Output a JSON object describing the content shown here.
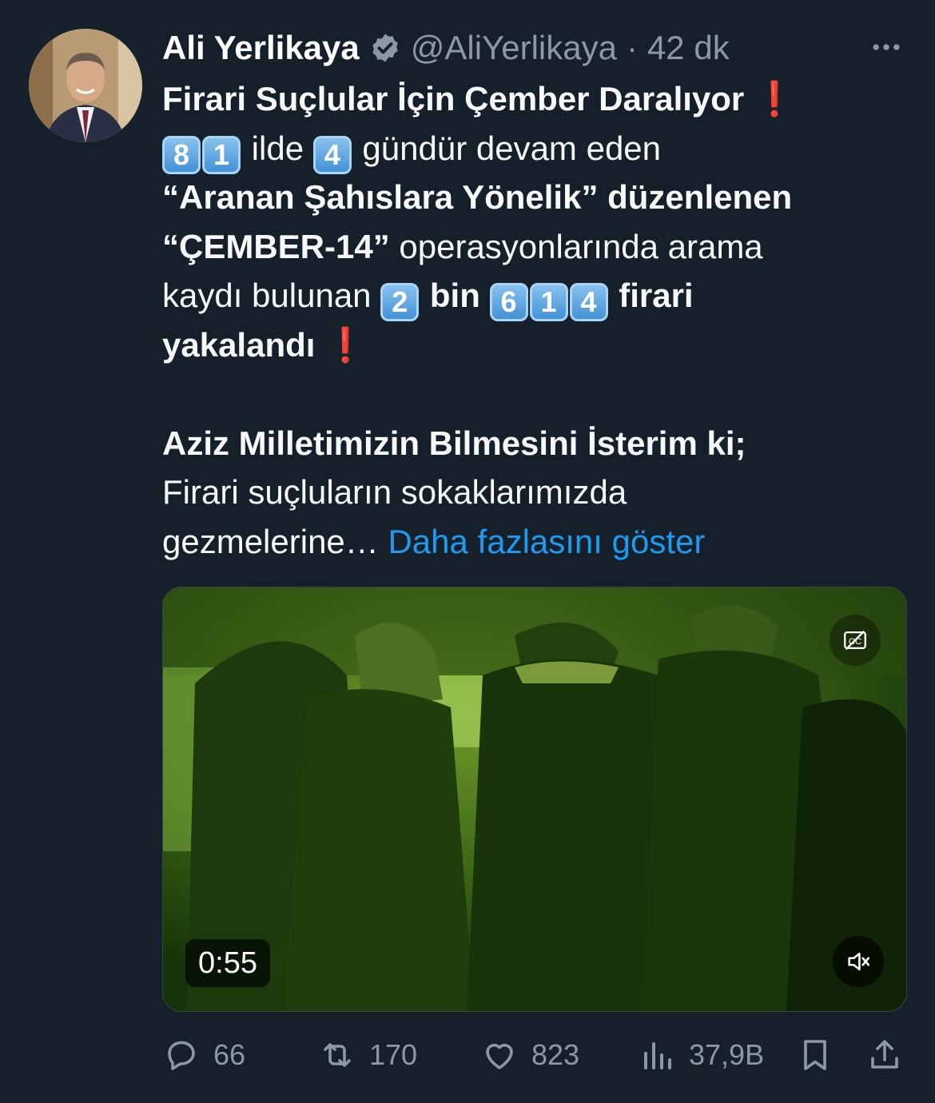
{
  "author": {
    "name": "Ali Yerlikaya",
    "handle": "@AliYerlikaya",
    "separator": "·",
    "time": "42 dk",
    "verified_icon": "verified-badge-icon",
    "more_icon": "more-horizontal-icon"
  },
  "tweet": {
    "line1": "Firari Suçlular İçin Çember Daralıyor",
    "exclamation": "❗",
    "line2": {
      "keys_a": [
        "8",
        "1"
      ],
      "t1": "ilde",
      "key_b": "4",
      "t2": "gündür devam eden"
    },
    "line3": {
      "bold": "“Aranan Şahıslara Yönelik” düzenlenen"
    },
    "line4": {
      "bold": "“ÇEMBER-14”",
      "normal": "operasyonlarında arama"
    },
    "line5": {
      "t1": "kaydı bulunan",
      "key_a": "2",
      "bold1": "bin",
      "keys_b": [
        "6",
        "1",
        "4"
      ],
      "bold2": "firari"
    },
    "line6": {
      "bold": "yakalandı"
    },
    "line7": "Aziz Milletimizin Bilmesini İsterim ki;",
    "line8": "Firari suçluların sokaklarımızda",
    "line9": "gezmelerine…",
    "show_more": "Daha fazlasını göster"
  },
  "media": {
    "duration": "0:55",
    "cc_icon": "captions-icon",
    "mute_icon": "volume-muted-icon"
  },
  "actions": {
    "replies": "66",
    "retweets": "170",
    "likes": "823",
    "views": "37,9B"
  },
  "colors": {
    "background": "#15202b",
    "text": "#f7f9f9",
    "secondary": "#8b98a5",
    "link": "#1d9bf0",
    "exclamation": "#e0243a"
  }
}
